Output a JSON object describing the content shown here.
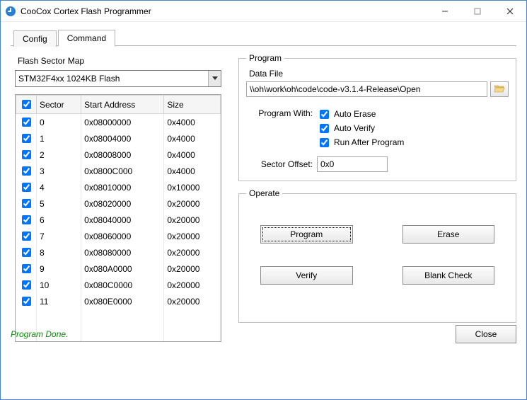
{
  "window": {
    "title": "CooCox Cortex Flash Programmer"
  },
  "tabs": {
    "config": "Config",
    "command": "Command"
  },
  "sector_map": {
    "label": "Flash Sector Map",
    "device": "STM32F4xx 1024KB Flash",
    "columns": {
      "sector": "Sector",
      "start": "Start Address",
      "size": "Size"
    },
    "rows": [
      {
        "sector": "0",
        "start": "0x08000000",
        "size": "0x4000"
      },
      {
        "sector": "1",
        "start": "0x08004000",
        "size": "0x4000"
      },
      {
        "sector": "2",
        "start": "0x08008000",
        "size": "0x4000"
      },
      {
        "sector": "3",
        "start": "0x0800C000",
        "size": "0x4000"
      },
      {
        "sector": "4",
        "start": "0x08010000",
        "size": "0x10000"
      },
      {
        "sector": "5",
        "start": "0x08020000",
        "size": "0x20000"
      },
      {
        "sector": "6",
        "start": "0x08040000",
        "size": "0x20000"
      },
      {
        "sector": "7",
        "start": "0x08060000",
        "size": "0x20000"
      },
      {
        "sector": "8",
        "start": "0x08080000",
        "size": "0x20000"
      },
      {
        "sector": "9",
        "start": "0x080A0000",
        "size": "0x20000"
      },
      {
        "sector": "10",
        "start": "0x080C0000",
        "size": "0x20000"
      },
      {
        "sector": "11",
        "start": "0x080E0000",
        "size": "0x20000"
      }
    ]
  },
  "program": {
    "group": "Program",
    "data_file_label": "Data File",
    "data_file": "\\\\oh\\work\\oh\\code\\code-v3.1.4-Release\\Open",
    "program_with_label": "Program With:",
    "auto_erase": "Auto Erase",
    "auto_verify": "Auto Verify",
    "run_after": "Run After Program",
    "sector_offset_label": "Sector Offset:",
    "sector_offset": "0x0"
  },
  "operate": {
    "group": "Operate",
    "program": "Program",
    "erase": "Erase",
    "verify": "Verify",
    "blank_check": "Blank Check"
  },
  "footer": {
    "status": "Program Done.",
    "close": "Close"
  }
}
